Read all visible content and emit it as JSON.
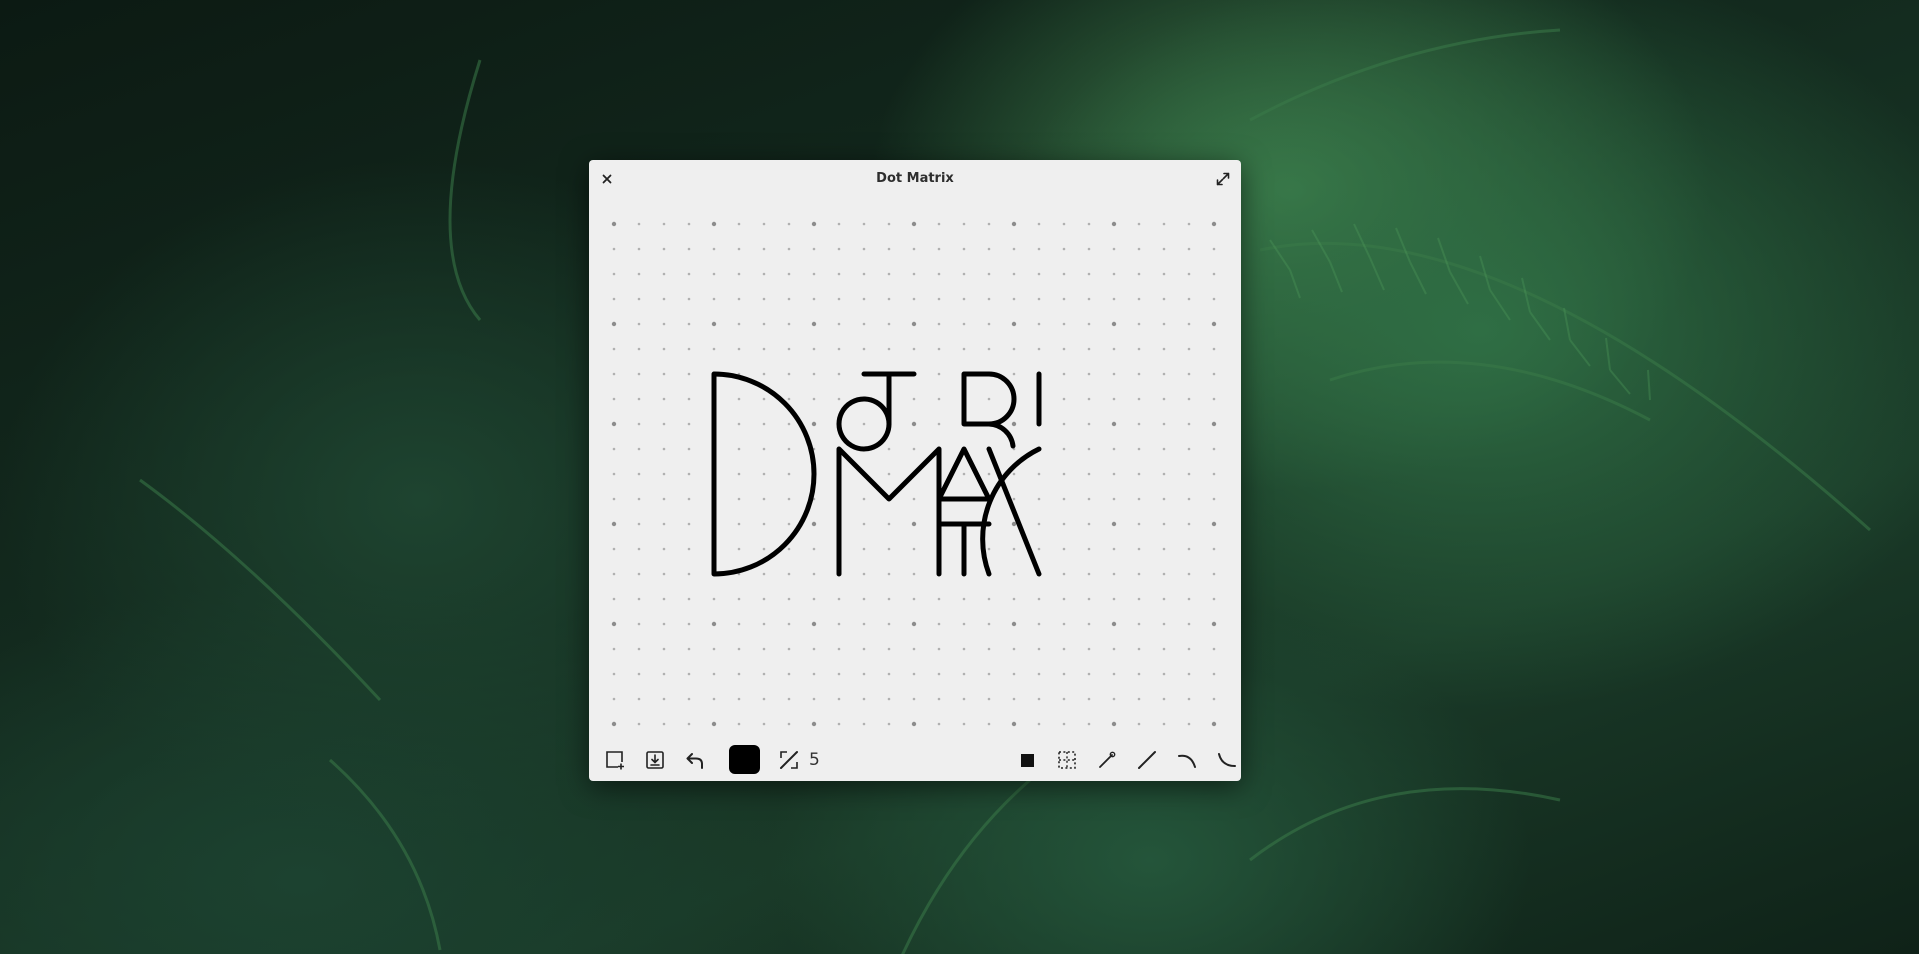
{
  "window": {
    "title": "Dot Matrix"
  },
  "toolbar": {
    "stroke_width": "5",
    "color": "#000000"
  },
  "tools": {
    "left": [
      "new-canvas-icon",
      "save-icon",
      "undo-icon",
      "color-swatch",
      "line-width-icon"
    ],
    "right": [
      "filled-square-icon",
      "dotted-square-icon",
      "line-tool-icon",
      "straight-line-icon",
      "curve-left-icon",
      "curve-right-icon"
    ]
  },
  "colors": {
    "window_bg": "#efefef",
    "stroke": "#000000",
    "dot": "#9a9a9a"
  }
}
